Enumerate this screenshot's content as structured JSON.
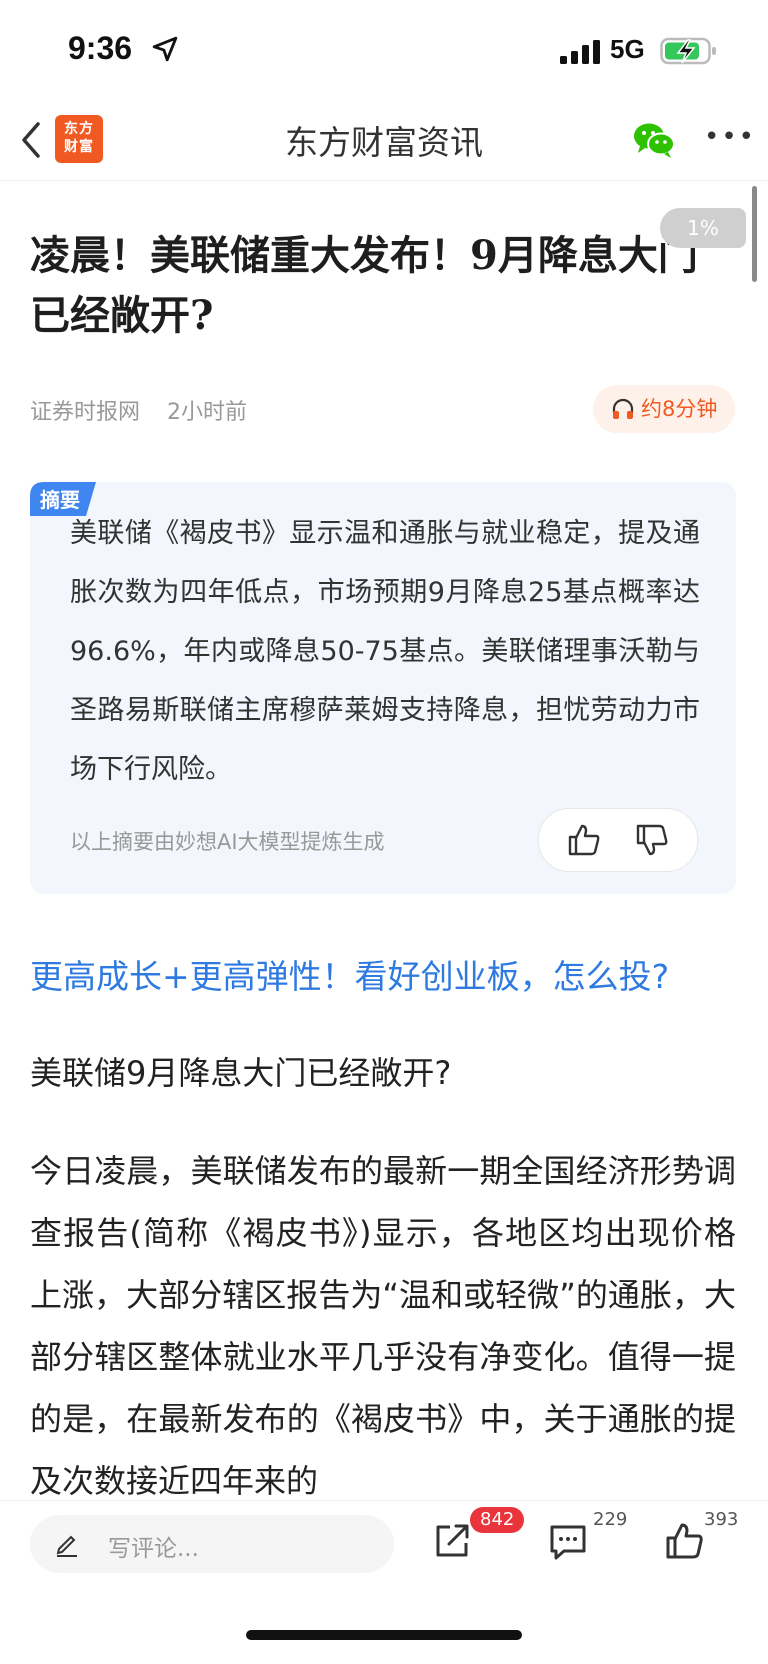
{
  "status_bar": {
    "time": "9:36",
    "network": "5G"
  },
  "nav": {
    "logo_line1": "东方",
    "logo_line2": "财富",
    "title": "东方财富资讯"
  },
  "reading_progress": "1%",
  "article": {
    "title": "凌晨！美联储重大发布！9月降息大门已经敞开?",
    "source": "证券时报网",
    "time": "2小时前",
    "audio_label": "约8分钟"
  },
  "summary": {
    "tag": "摘要",
    "text": "美联储《褐皮书》显示温和通胀与就业稳定，提及通胀次数为四年低点，市场预期9月降息25基点概率达96.6%，年内或降息50-75基点。美联储理事沃勒与圣路易斯联储主席穆萨莱姆支持降息，担忧劳动力市场下行风险。",
    "ai_note": "以上摘要由妙想AI大模型提炼生成"
  },
  "promo_link": "更高成长+更高弹性！看好创业板，怎么投?",
  "subheading": "美联储9月降息大门已经敞开?",
  "body_text": "今日凌晨，美联储发布的最新一期全国经济形势调查报告(简称《褐皮书》)显示，各地区均出现价格上涨，大部分辖区报告为“温和或轻微”的通胀，大部分辖区整体就业水平几乎没有净变化。值得一提的是，在最新发布的《褐皮书》中，关于通胀的提及次数接近四年来的",
  "bottom_bar": {
    "comment_placeholder": "写评论...",
    "share_badge": "842",
    "comment_count": "229",
    "like_count": "393"
  },
  "colors": {
    "brand": "#f05a22",
    "link": "#2f7ae0",
    "summary_bg": "#f3f6fc",
    "badge": "#e8343a"
  },
  "icons": [
    "location-arrow-icon",
    "signal-icon",
    "battery-charging-icon",
    "back-icon",
    "wechat-icon",
    "more-icon",
    "headphones-icon",
    "thumbs-up-icon",
    "thumbs-down-icon",
    "pencil-icon",
    "share-icon",
    "comment-icon",
    "like-icon"
  ]
}
